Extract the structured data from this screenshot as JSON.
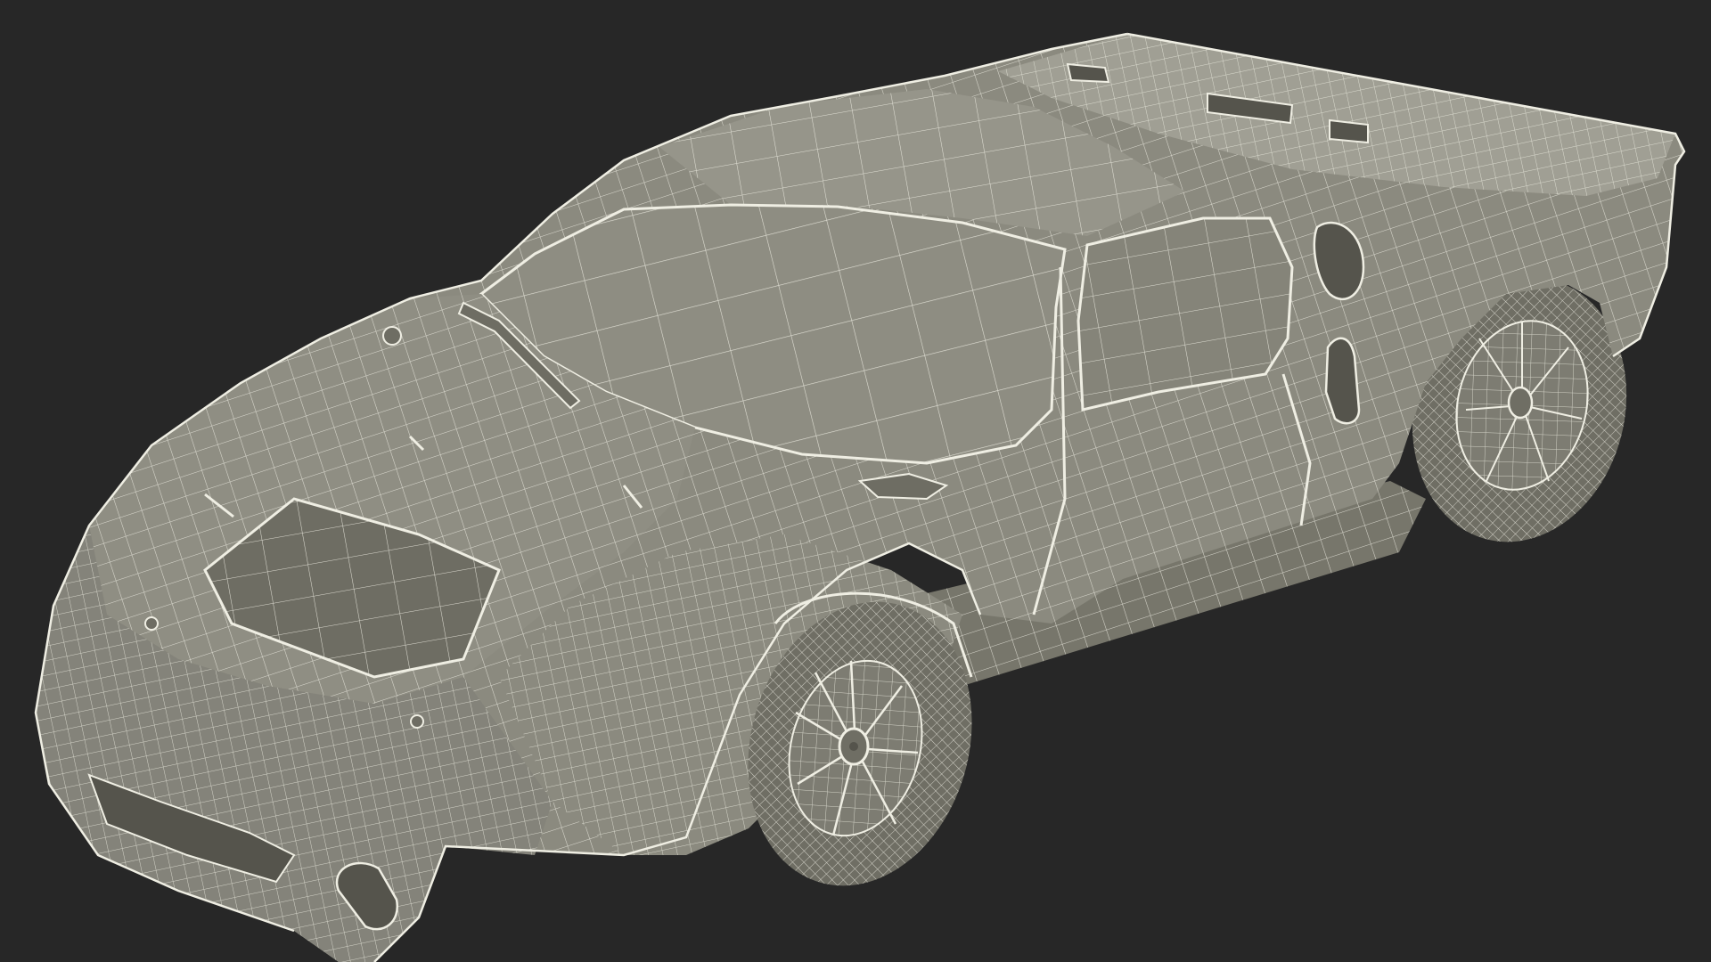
{
  "scene": {
    "subject": "wireframe-race-car",
    "colors": {
      "background": "#272727",
      "body_fill": "#8b8a7f",
      "body_shade": "#77766b",
      "body_light": "#a09f94",
      "opening": "#55544c",
      "tire": "#6f6e64",
      "wire": "#efeee3"
    }
  }
}
